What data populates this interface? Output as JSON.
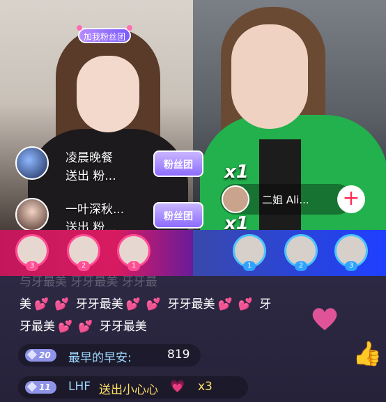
{
  "left_stream": {
    "fan_tag_label": "加我粉丝团",
    "gift_popups": [
      {
        "name": "凌晨晚餐",
        "action": "送出 粉...",
        "badge": "粉丝团"
      },
      {
        "name": "一叶深秋...",
        "action": "送出 粉...",
        "badge": "粉丝团"
      }
    ]
  },
  "right_stream": {
    "multiplier_1": "x1",
    "multiplier_2": "x1",
    "user_name": "二姐 Ali...",
    "follow_icon": "plus-icon",
    "follow_label": "+"
  },
  "rank_bar": {
    "left_ranks": [
      "3",
      "2",
      "1"
    ],
    "right_ranks": [
      "1",
      "2",
      "3"
    ],
    "left_color": "#d81b60",
    "right_color": "#1e40ff"
  },
  "chat": {
    "faded_line": "与牙最美    牙牙最美    牙牙最",
    "line1": "美",
    "line1_tail": "牙牙最美",
    "line1_tail2": "牙牙最美",
    "line1_tail3": "牙",
    "line2": "牙最美",
    "line2_tail": "牙牙最美",
    "messages": [
      {
        "level": "20",
        "user": "最早的早安:",
        "text": "819"
      },
      {
        "level": "11",
        "user": "LHF",
        "text": "送出小心心",
        "suffix": "x3"
      }
    ],
    "heart_icon": "heart-icon",
    "thumb_icon": "thumbs-up-icon",
    "thumb_glyph": "👍"
  }
}
